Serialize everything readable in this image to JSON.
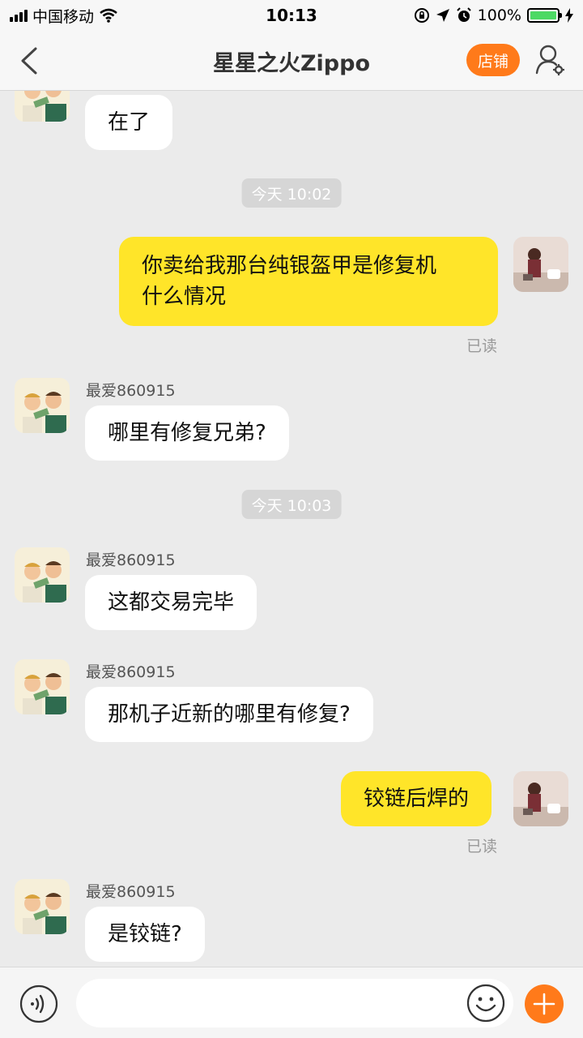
{
  "status_bar": {
    "carrier": "中国移动",
    "time": "10:13",
    "battery": "100%"
  },
  "nav": {
    "title": "星星之火Zippo",
    "shop_label": "店铺"
  },
  "messages": [
    {
      "type": "in",
      "text": "在了"
    },
    {
      "type": "time",
      "text": "今天 10:02"
    },
    {
      "type": "out",
      "line1": "你卖给我那台纯银盔甲是修复机",
      "line2": "什么情况",
      "read": "已读"
    },
    {
      "type": "in",
      "sender": "最爱860915",
      "text": "哪里有修复兄弟?"
    },
    {
      "type": "time",
      "text": "今天 10:03"
    },
    {
      "type": "in",
      "sender": "最爱860915",
      "text": "这都交易完毕"
    },
    {
      "type": "in",
      "sender": "最爱860915",
      "text": "那机子近新的哪里有修复?"
    },
    {
      "type": "out",
      "text": "铰链后焊的",
      "read": "已读"
    },
    {
      "type": "in",
      "sender": "最爱860915",
      "text": "是铰链?"
    }
  ],
  "input": {
    "value": "",
    "placeholder": ""
  },
  "colors": {
    "accent": "#ff7a1a",
    "outgoing_bubble": "#ffe529",
    "incoming_bubble": "#ffffff",
    "background": "#ebebeb"
  }
}
